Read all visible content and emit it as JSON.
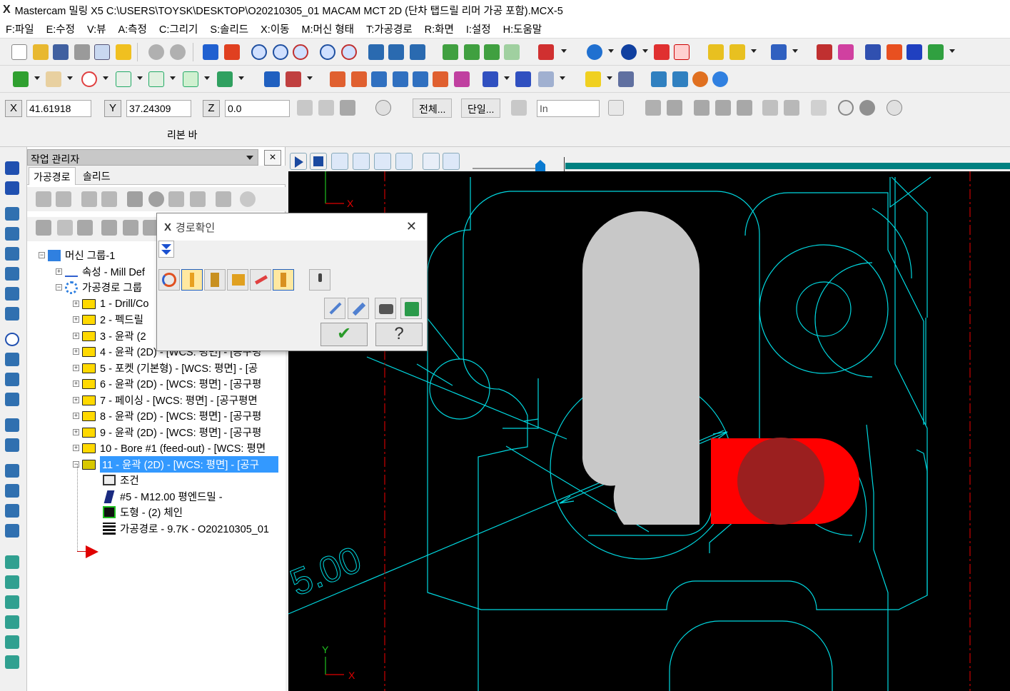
{
  "app": {
    "title": "Mastercam 밀링 X5  C:\\USERS\\TOYSK\\DESKTOP\\O20210305_01 MACAM MCT 2D (단차 탭드릴 리머 가공 포함).MCX-5",
    "accent": "#3399ff"
  },
  "menu": [
    "F:파일",
    "E:수정",
    "V:뷰",
    "A:측정",
    "C:그리기",
    "S:솔리드",
    "X:이동",
    "M:머신 형태",
    "T:가공경로",
    "R:화면",
    "I:설정",
    "H:도움말"
  ],
  "coords": {
    "x_label": "X",
    "x_value": "41.61918",
    "y_label": "Y",
    "y_value": "37.24309",
    "z_label": "Z",
    "z_value": "0.0",
    "btn_all": "전체...",
    "btn_single": "단일...",
    "unit_value": "In"
  },
  "ribbon": {
    "label": "리본 바"
  },
  "ops_manager": {
    "title": "작업 관리자",
    "close": "×",
    "tabs": [
      "가공경로",
      "솔리드"
    ],
    "tree": [
      {
        "text": "머신 그룹-1",
        "level": 0
      },
      {
        "text": "속성 - Mill Def",
        "level": 1
      },
      {
        "text": "가공경로 그룹",
        "level": 1
      },
      {
        "text": "1 - Drill/Co",
        "level": 2
      },
      {
        "text": "2 - 펙드릴",
        "level": 2
      },
      {
        "text": "3 - 윤곽 (2",
        "level": 2
      },
      {
        "text": "4 - 윤곽 (2D) - [WCS: 평면] - [공구평",
        "level": 2
      },
      {
        "text": "5 - 포켓 (기본형) - [WCS: 평면] - [공",
        "level": 2
      },
      {
        "text": "6 - 윤곽 (2D) - [WCS: 평면] - [공구평",
        "level": 2
      },
      {
        "text": "7 - 페이싱 - [WCS: 평면] - [공구평면",
        "level": 2
      },
      {
        "text": "8 - 윤곽 (2D) - [WCS: 평면] - [공구평",
        "level": 2
      },
      {
        "text": "9 - 윤곽 (2D) - [WCS: 평면] - [공구평",
        "level": 2
      },
      {
        "text": "10 - Bore #1 (feed-out) - [WCS: 평면",
        "level": 2
      },
      {
        "text": "11 - 윤곽 (2D) - [WCS: 평면] - [공구",
        "level": 2
      },
      {
        "text": "조건",
        "level": 3
      },
      {
        "text": "#5 - M12.00 평엔드밀 -",
        "level": 3
      },
      {
        "text": "도형 - (2) 체인",
        "level": 3
      },
      {
        "text": "가공경로 - 9.7K - O20210305_01",
        "level": 3
      }
    ],
    "selected_index": 13
  },
  "dialog": {
    "title": "경로확인",
    "close": "✕"
  },
  "viewport": {
    "axis_top": {
      "y": "Y",
      "x": "X"
    },
    "axis_bottom": {
      "y": "Y",
      "x": "X"
    },
    "dim_text": "5.00",
    "colors": {
      "geometry": "#00d8e0",
      "stock": "#c8c8c8",
      "tool": "#ff0000",
      "tool_core": "#9b1f1f",
      "centerline": "#cc0000"
    }
  },
  "icons": [
    "new-file-icon",
    "open-icon",
    "save-icon",
    "print-icon",
    "zoom-icon",
    "undo-icon",
    "redo-icon",
    "check-icon",
    "help-icon",
    "play-icon",
    "stop-icon",
    "first-icon",
    "rewind-icon",
    "forward-icon",
    "last-icon"
  ]
}
